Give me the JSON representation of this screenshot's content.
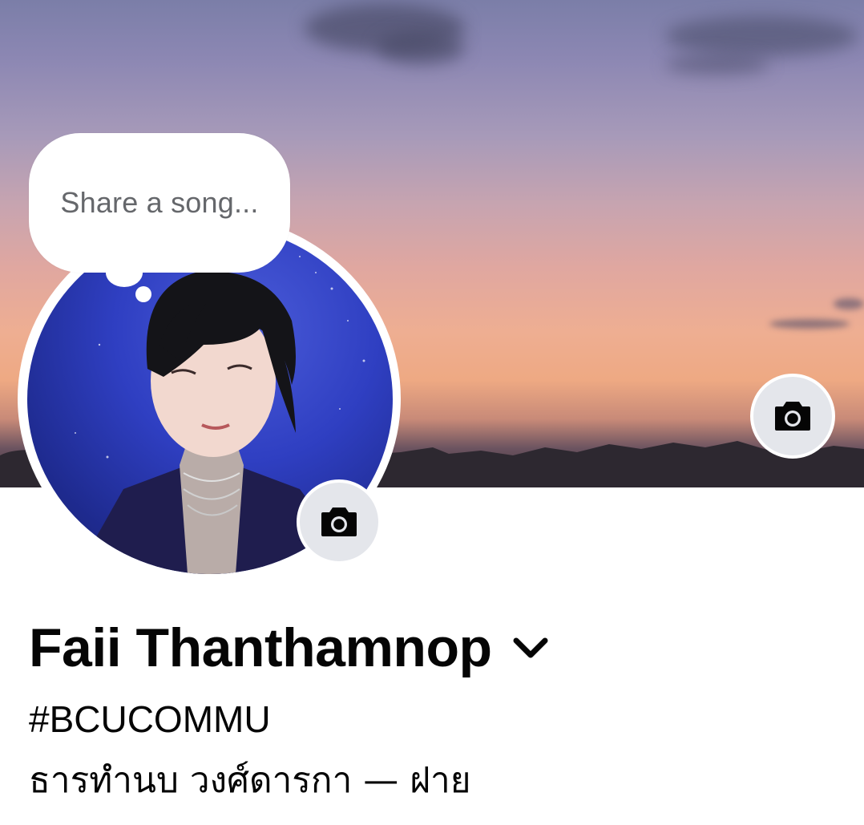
{
  "status_bubble": {
    "placeholder": "Share a song..."
  },
  "profile": {
    "name": "Faii Thanthamnop",
    "bio_line1": "#BCUCOMMU",
    "bio_line2": "ธารทำนบ วงศ์ดารกา — ฝาย"
  },
  "icons": {
    "cover_camera": "camera-icon",
    "profile_camera": "camera-icon",
    "name_dropdown": "chevron-down-icon"
  },
  "colors": {
    "camera_button_bg": "#e4e6eb",
    "text_primary": "#050505",
    "text_secondary": "#65676b"
  }
}
